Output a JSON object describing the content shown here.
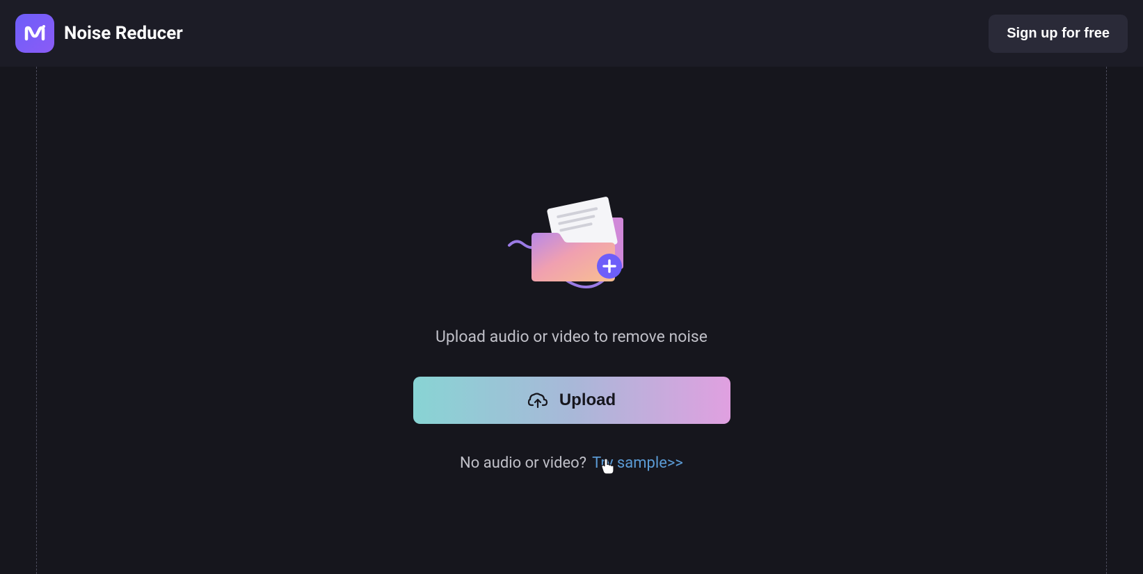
{
  "header": {
    "app_title": "Noise Reducer",
    "signup_label": "Sign up for free"
  },
  "main": {
    "instruction": "Upload audio or video to remove noise",
    "upload_button_label": "Upload",
    "sample_question": "No audio or video?",
    "sample_link_label": "Try sample>>"
  },
  "colors": {
    "background": "#16161d",
    "header_bg": "#1c1c26",
    "accent_purple": "#6d5ef9",
    "link_blue": "#5b9bd5",
    "button_gradient_start": "#88d4d4",
    "button_gradient_end": "#e0a0e0"
  }
}
